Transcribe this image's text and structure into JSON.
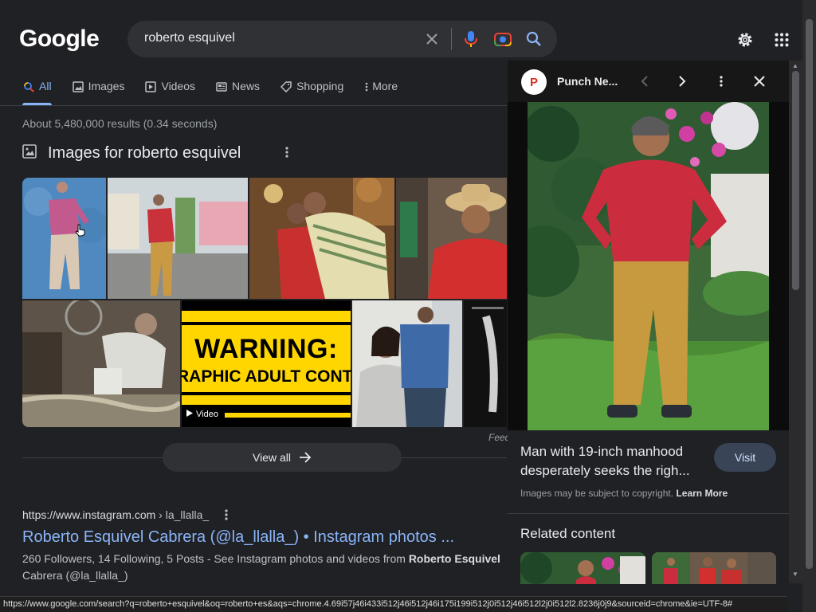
{
  "header": {
    "logo": "Google",
    "search_query": "roberto esquivel"
  },
  "tabs": [
    {
      "label": "All",
      "icon": "search-icon",
      "active": true
    },
    {
      "label": "Images",
      "icon": "image-icon"
    },
    {
      "label": "Videos",
      "icon": "video-icon"
    },
    {
      "label": "News",
      "icon": "news-icon"
    },
    {
      "label": "Shopping",
      "icon": "tag-icon"
    },
    {
      "label": "More",
      "icon": "more-vert-icon"
    }
  ],
  "stats": "About 5,480,000 results (0.34 seconds)",
  "images_section": {
    "title": "Images for roberto esquivel",
    "warning_line1": "WARNING:",
    "warning_line2": "RAPHIC ADULT CONTEN",
    "video_label": "Video",
    "feedback": "Feedb",
    "view_all": "View all"
  },
  "result": {
    "url": "https://www.instagram.com",
    "path": " › la_llalla_",
    "title": "Roberto Esquivel Cabrera (@la_llalla_) • Instagram photos ...",
    "snippet_pre": "260 Followers, 14 Following, 5 Posts - See Instagram photos and videos from ",
    "snippet_bold": "Roberto Esquivel",
    "snippet_post": "Cabrera (@la_llalla_)"
  },
  "panel": {
    "source_name": "Punch Ne...",
    "source_initial": "P",
    "caption": "Man with 19-inch manhood desperately seeks the righ...",
    "visit": "Visit",
    "copyright_pre": "Images may be subject to copyright. ",
    "copyright_link": "Learn More",
    "related_heading": "Related content"
  },
  "status_url": "https://www.google.com/search?q=roberto+esquivel&oq=roberto+es&aqs=chrome.4.69i57j46i433i512j46i512j46i175i199i512j0i512j46i512l2j0i512l2.8236j0j9&sourceid=chrome&ie=UTF-8#",
  "colors": {
    "background": "#202124",
    "link": "#8ab4f8",
    "accent_tab": "#8ab4f8",
    "warning_yellow": "#ffd600"
  }
}
